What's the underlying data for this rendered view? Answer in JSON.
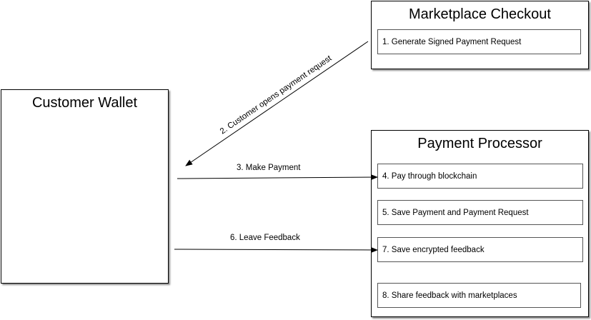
{
  "marketplace": {
    "title": "Marketplace Checkout",
    "steps": [
      "1. Generate Signed Payment Request"
    ]
  },
  "wallet": {
    "title": "Customer Wallet"
  },
  "processor": {
    "title": "Payment Processor",
    "steps": [
      "4. Pay through blockchain",
      "5. Save Payment and Payment Request",
      "7. Save encrypted feedback",
      "8. Share feedback with marketplaces"
    ]
  },
  "arrows": {
    "open_request": "2. Customer opens payment request",
    "make_payment": "3. Make Payment",
    "leave_feedback": "6. Leave Feedback"
  }
}
